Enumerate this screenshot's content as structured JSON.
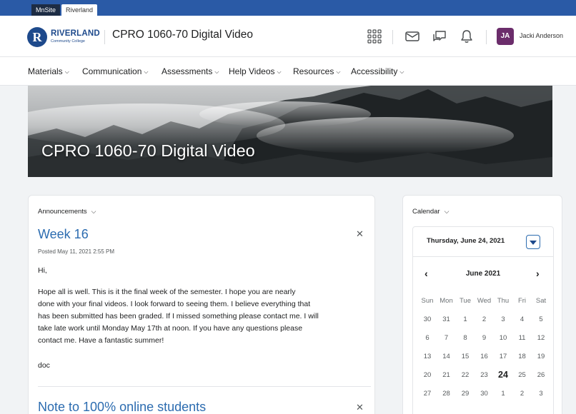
{
  "sitebar": {
    "tabs": [
      "MnSite",
      "Riverland"
    ]
  },
  "header": {
    "logo_name": "RIVERLAND",
    "logo_sub": "Community College",
    "logo_letter": "R",
    "course_title": "CPRO 1060-70 Digital Video",
    "user_initials": "JA",
    "user_name": "Jacki Anderson"
  },
  "nav": [
    {
      "label": "Materials"
    },
    {
      "label": "Communication"
    },
    {
      "label": "Assessments"
    },
    {
      "label": "Help Videos"
    },
    {
      "label": "Resources"
    },
    {
      "label": "Accessibility"
    }
  ],
  "banner": {
    "title": "CPRO 1060-70 Digital Video"
  },
  "announcements": {
    "heading": "Announcements",
    "items": [
      {
        "title": "Week 16",
        "posted": "Posted May 11, 2021 2:55 PM",
        "greeting": "Hi,",
        "body_lines": [
          "Hope all is well.  This is it the final week of the semester.  I hope you are nearly",
          "done with your final videos.  I look forward to seeing them.  I believe everything that",
          "has been submitted has been graded.  If I missed something please contact me.  I will",
          "take late work until Monday May 17th at noon.  If  you have any questions please",
          "contact me.  Have a fantastic summer!"
        ],
        "signoff": "doc"
      },
      {
        "title": "Note to 100% online students"
      }
    ]
  },
  "calendar": {
    "heading": "Calendar",
    "selected_date": "Thursday, June 24, 2021",
    "month_label": "June 2021",
    "weekdays": [
      "Sun",
      "Mon",
      "Tue",
      "Wed",
      "Thu",
      "Fri",
      "Sat"
    ],
    "weeks": [
      [
        "30",
        "31",
        "1",
        "2",
        "3",
        "4",
        "5"
      ],
      [
        "6",
        "7",
        "8",
        "9",
        "10",
        "11",
        "12"
      ],
      [
        "13",
        "14",
        "15",
        "16",
        "17",
        "18",
        "19"
      ],
      [
        "20",
        "21",
        "22",
        "23",
        "24",
        "25",
        "26"
      ],
      [
        "27",
        "28",
        "29",
        "30",
        "1",
        "2",
        "3"
      ]
    ],
    "today": "24"
  },
  "icons": {
    "apps": "grid-icon",
    "mail": "envelope-icon",
    "chat": "chat-icon",
    "alerts": "bell-icon",
    "close": "close-icon",
    "chevron": "chevron-down-icon"
  },
  "colors": {
    "brand": "#2a5aa6",
    "link": "#2c6cb0",
    "avatar": "#6b2d6b"
  }
}
